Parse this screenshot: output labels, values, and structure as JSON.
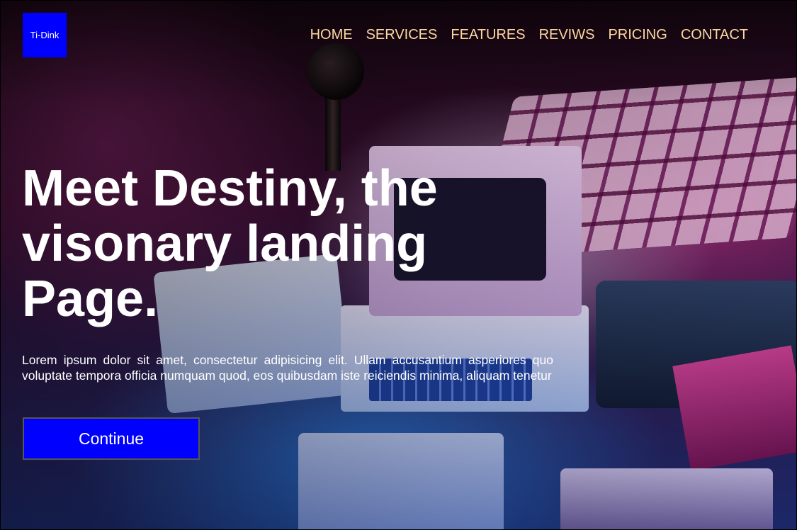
{
  "brand": {
    "logo_text": "Ti-Dink",
    "accent_color": "#0000ff",
    "nav_color": "#ffd8a0"
  },
  "nav": {
    "items": [
      {
        "label": "HOME"
      },
      {
        "label": "SERVICES"
      },
      {
        "label": "FEATURES"
      },
      {
        "label": "REVIWS"
      },
      {
        "label": "PRICING"
      },
      {
        "label": "CONTACT"
      }
    ]
  },
  "hero": {
    "headline": "Meet Destiny, the visonary landing Page.",
    "paragraph": "Lorem ipsum dolor sit amet, consectetur adipisicing elit. Ullam accusantium asperiores quo voluptate tempora officia numquam quod, eos quibusdam iste reiciendis minima, aliquam tenetur",
    "cta_label": "Continue"
  }
}
